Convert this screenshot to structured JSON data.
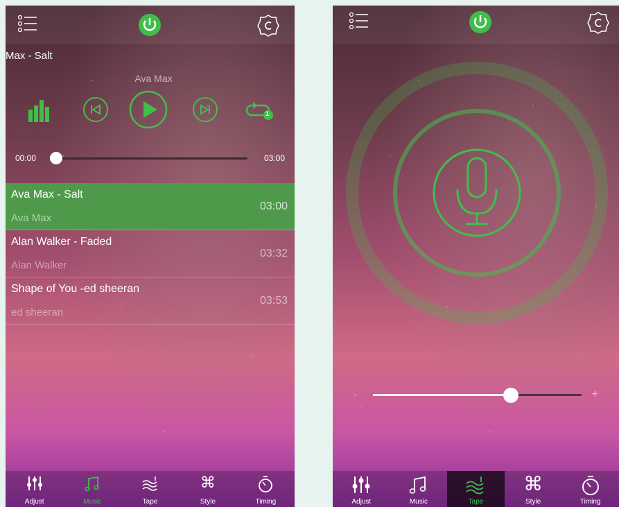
{
  "left": {
    "now_playing_scroll": "Max - Salt",
    "now_playing_artist": "Ava Max",
    "progress": {
      "current": "00:00",
      "total": "03:00",
      "fraction": 0.0
    },
    "songs": [
      {
        "name": "Ava Max - Salt",
        "artist": "Ava Max",
        "duration": "03:00",
        "active": true
      },
      {
        "name": "Alan Walker - Faded",
        "artist": "Alan Walker",
        "duration": "03:32",
        "active": false
      },
      {
        "name": "Shape of You -ed sheeran",
        "artist": "ed sheeran",
        "duration": "03:53",
        "active": false
      }
    ],
    "repeat_badge": "1"
  },
  "right": {
    "volume_fraction": 0.57,
    "minus_label": "-",
    "plus_label": "+"
  },
  "tabs": [
    {
      "label": "Adjust",
      "icon": "sliders-icon"
    },
    {
      "label": "Music",
      "icon": "music-note-icon"
    },
    {
      "label": "Tape",
      "icon": "waves-icon"
    },
    {
      "label": "Style",
      "icon": "command-icon"
    },
    {
      "label": "Timing",
      "icon": "stopwatch-icon"
    }
  ],
  "colors": {
    "accent": "#3fbf4a",
    "active_row": "#4f9a4a"
  }
}
